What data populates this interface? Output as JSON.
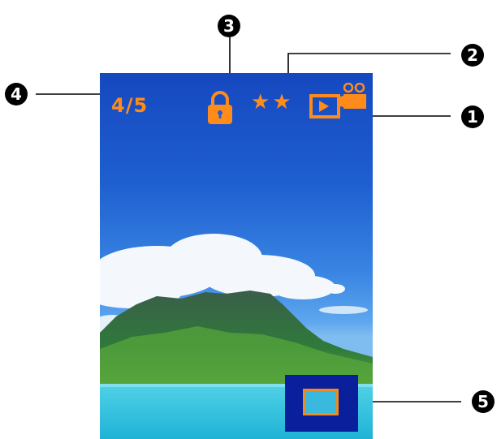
{
  "screen": {
    "image_counter": "4/5",
    "lock_icon": "lock-icon",
    "rating": {
      "stars": [
        "★",
        "★"
      ],
      "value": 2,
      "max": 2
    },
    "mode_icon": "video-playback-icon",
    "zoom_indicator": "zoom-position-indicator"
  },
  "callouts": {
    "c1": "1",
    "c2": "2",
    "c3": "3",
    "c4": "4",
    "c5": "5"
  },
  "colors": {
    "hud_orange": "#ff8c1a",
    "sky_blue": "#1e5fd0",
    "callout_black": "#000000",
    "zoom_box_blue": "#0a1f9c"
  }
}
